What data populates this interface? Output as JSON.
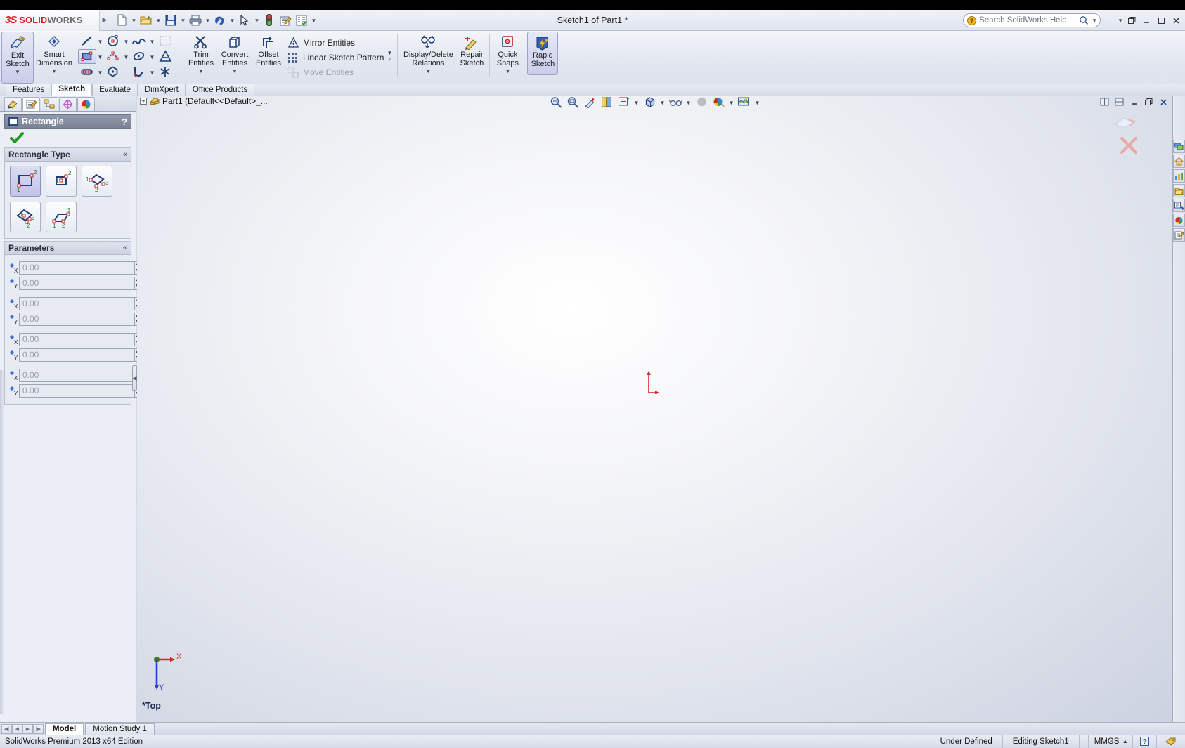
{
  "app": {
    "brand_mark": "3S",
    "brand_word_a": "SOLID",
    "brand_word_b": "WORKS",
    "document_title": "Sketch1 of Part1 *"
  },
  "search": {
    "placeholder": "Search SolidWorks Help",
    "icon": "help-search-icon"
  },
  "window_controls": {
    "restore_small": "restore-icon",
    "minimize": "minimize-icon",
    "maximize": "maximize-icon",
    "close": "close-icon",
    "help": "help-icon"
  },
  "quick_access": [
    {
      "name": "new-document",
      "icon": "new-doc-icon",
      "caret": true
    },
    {
      "name": "open-document",
      "icon": "open-folder-icon",
      "caret": true
    },
    {
      "name": "save-document",
      "icon": "save-disk-icon",
      "caret": true
    },
    {
      "name": "print-document",
      "icon": "printer-icon",
      "caret": true
    },
    {
      "name": "undo",
      "icon": "undo-arrow-icon",
      "caret": true
    },
    {
      "name": "select",
      "icon": "cursor-arrow-icon",
      "caret": true
    },
    {
      "name": "rebuild",
      "icon": "traffic-light-icon",
      "caret": false
    },
    {
      "name": "file-properties",
      "icon": "file-properties-icon",
      "caret": false
    },
    {
      "name": "options",
      "icon": "options-list-icon",
      "caret": true
    }
  ],
  "ribbon": {
    "exit_sketch": {
      "label_line1": "Exit",
      "label_line2": "Sketch",
      "icon": "exit-sketch-icon"
    },
    "smart_dimension": {
      "label_line1": "Smart",
      "label_line2": "Dimension",
      "icon": "smart-dimension-icon"
    },
    "sketch_tools": [
      {
        "name": "line-tool",
        "icon": "line-icon",
        "caret": true,
        "selected": false
      },
      {
        "name": "rectangle-tool",
        "icon": "rectangle-icon",
        "caret": true,
        "selected": true
      },
      {
        "name": "slot-tool",
        "icon": "slot-icon",
        "caret": true,
        "selected": false
      },
      {
        "name": "circle-tool",
        "icon": "circle-icon",
        "caret": true,
        "selected": false
      },
      {
        "name": "spline-point-tool",
        "icon": "spline-point-icon",
        "caret": true,
        "selected": false
      },
      {
        "name": "polygon-tool",
        "icon": "polygon-icon",
        "caret": false,
        "selected": false
      },
      {
        "name": "spline-tool",
        "icon": "spline-icon",
        "caret": true,
        "selected": false
      },
      {
        "name": "ellipse-tool",
        "icon": "ellipse-icon",
        "caret": true,
        "selected": false
      },
      {
        "name": "arc-tool",
        "icon": "arc-icon",
        "caret": true,
        "selected": false
      },
      {
        "name": "sketch-fillet-tool",
        "icon": "sketch-fillet-icon",
        "caret": false,
        "selected": false
      },
      {
        "name": "text-tool",
        "icon": "sketch-text-icon",
        "caret": false,
        "selected": false
      },
      {
        "name": "point-tool",
        "icon": "point-asterisk-icon",
        "caret": false,
        "selected": false
      }
    ],
    "trim_entities": {
      "label_line1": "Trim",
      "label_line2": "Entities",
      "icon": "trim-entities-icon"
    },
    "convert_entities": {
      "label_line1": "Convert",
      "label_line2": "Entities",
      "icon": "convert-entities-icon"
    },
    "offset_entities": {
      "label_line1": "Offset",
      "label_line2": "Entities",
      "icon": "offset-entities-icon"
    },
    "list_items": [
      {
        "name": "mirror-entities",
        "label": "Mirror Entities",
        "icon": "mirror-entities-icon",
        "caret": false,
        "disabled": false
      },
      {
        "name": "linear-sketch-pattern",
        "label": "Linear Sketch Pattern",
        "icon": "linear-sketch-pattern-icon",
        "caret": true,
        "disabled": false
      },
      {
        "name": "move-entities",
        "label": "Move Entities",
        "icon": "move-entities-icon",
        "caret": true,
        "disabled": true
      }
    ],
    "display_delete_relations": {
      "label_line1": "Display/Delete",
      "label_line2": "Relations",
      "icon": "display-delete-relations-icon"
    },
    "repair_sketch": {
      "label_line1": "Repair",
      "label_line2": "Sketch",
      "icon": "repair-sketch-icon"
    },
    "quick_snaps": {
      "label_line1": "Quick",
      "label_line2": "Snaps",
      "icon": "quick-snaps-icon"
    },
    "rapid_sketch": {
      "label_line1": "Rapid",
      "label_line2": "Sketch",
      "icon": "rapid-sketch-icon",
      "selected": true
    }
  },
  "command_tabs": [
    {
      "name": "tab-features",
      "label": "Features",
      "active": false
    },
    {
      "name": "tab-sketch",
      "label": "Sketch",
      "active": true
    },
    {
      "name": "tab-evaluate",
      "label": "Evaluate",
      "active": false
    },
    {
      "name": "tab-dimxpert",
      "label": "DimXpert",
      "active": false
    },
    {
      "name": "tab-office-products",
      "label": "Office Products",
      "active": false
    }
  ],
  "property_manager": {
    "tabs": [
      {
        "name": "pm-tab-feature-tree",
        "icon": "feature-tree-icon",
        "active": false
      },
      {
        "name": "pm-tab-property-manager",
        "icon": "property-manager-icon",
        "active": true
      },
      {
        "name": "pm-tab-configuration-manager",
        "icon": "configuration-manager-icon",
        "active": false
      },
      {
        "name": "pm-tab-dimxpert-manager",
        "icon": "dimxpert-manager-icon",
        "active": false
      },
      {
        "name": "pm-tab-display-manager",
        "icon": "display-manager-icon",
        "active": false
      }
    ],
    "title": "Rectangle",
    "title_icon": "rectangle-icon",
    "help_glyph": "?",
    "ok_button": "ok-check-icon",
    "sections": {
      "rectangle_type": {
        "label": "Rectangle Type",
        "collapse_glyph": "«",
        "options": [
          {
            "name": "corner-rectangle",
            "icon": "corner-rectangle-icon",
            "selected": true
          },
          {
            "name": "center-rectangle",
            "icon": "center-rectangle-icon",
            "selected": false
          },
          {
            "name": "3-point-corner-rectangle",
            "icon": "three-point-corner-rectangle-icon",
            "selected": false
          },
          {
            "name": "3-point-center-rectangle",
            "icon": "three-point-center-rectangle-icon",
            "selected": false
          },
          {
            "name": "parallelogram",
            "icon": "parallelogram-icon",
            "selected": false
          }
        ]
      },
      "parameters": {
        "label": "Parameters",
        "collapse_glyph": "«",
        "fields": [
          {
            "name": "point1-x",
            "axis": "X",
            "value": "0.00"
          },
          {
            "name": "point1-y",
            "axis": "Y",
            "value": "0.00"
          },
          {
            "name": "point2-x",
            "axis": "X",
            "value": "0.00"
          },
          {
            "name": "point2-y",
            "axis": "Y",
            "value": "0.00"
          },
          {
            "name": "point3-x",
            "axis": "X",
            "value": "0.00"
          },
          {
            "name": "point3-y",
            "axis": "Y",
            "value": "0.00"
          },
          {
            "name": "point4-x",
            "axis": "X",
            "value": "0.00"
          },
          {
            "name": "point4-y",
            "axis": "Y",
            "value": "0.00"
          }
        ]
      }
    }
  },
  "feature_tree": {
    "root_label": "Part1 (Default<<Default>_...",
    "expand_glyph": "+",
    "icon": "part-icon"
  },
  "heads_up_view": [
    {
      "name": "zoom-to-fit",
      "icon": "zoom-to-fit-icon",
      "caret": false
    },
    {
      "name": "zoom-to-area",
      "icon": "zoom-to-area-icon",
      "caret": false
    },
    {
      "name": "previous-view",
      "icon": "previous-view-icon",
      "caret": false
    },
    {
      "name": "section-view",
      "icon": "section-view-icon",
      "caret": false
    },
    {
      "name": "view-orientation",
      "icon": "view-orientation-icon",
      "caret": true
    },
    {
      "name": "display-style",
      "icon": "display-style-icon",
      "caret": true
    },
    {
      "name": "hide-show-items",
      "icon": "hide-show-items-icon",
      "caret": true
    },
    {
      "name": "edit-appearance",
      "icon": "edit-appearance-icon",
      "caret": false
    },
    {
      "name": "apply-scene",
      "icon": "apply-scene-icon",
      "caret": true
    },
    {
      "name": "view-settings",
      "icon": "view-settings-icon",
      "caret": true
    }
  ],
  "view_corner_buttons": [
    {
      "name": "viewport-single",
      "icon": "viewport-single-icon"
    },
    {
      "name": "viewport-split",
      "icon": "viewport-split-icon"
    },
    {
      "name": "window-minimize",
      "icon": "minimize-icon"
    },
    {
      "name": "window-restore",
      "icon": "restore-icon"
    },
    {
      "name": "window-close",
      "icon": "close-icon"
    }
  ],
  "graphics": {
    "view_label": "*Top",
    "axis_x_label": "X",
    "axis_y_label": "Y",
    "origin_color": "#d02a2a"
  },
  "task_pane": [
    {
      "name": "task-pane-solidworks-resources",
      "icon": "sw-resources-icon"
    },
    {
      "name": "task-pane-design-library",
      "icon": "design-library-home-icon"
    },
    {
      "name": "task-pane-file-explorer",
      "icon": "file-explorer-icon"
    },
    {
      "name": "task-pane-search",
      "icon": "open-folder-icon"
    },
    {
      "name": "task-pane-view-palette",
      "icon": "view-palette-icon"
    },
    {
      "name": "task-pane-appearances-scenes",
      "icon": "appearances-scenes-icon"
    },
    {
      "name": "task-pane-custom-properties",
      "icon": "custom-properties-icon"
    }
  ],
  "bottom_tabs": {
    "nav": [
      "first",
      "previous",
      "next",
      "last"
    ],
    "tabs": [
      {
        "name": "bottom-tab-model",
        "label": "Model",
        "active": true
      },
      {
        "name": "bottom-tab-motion-study",
        "label": "Motion Study 1",
        "active": false
      }
    ]
  },
  "status_bar": {
    "edition": "SolidWorks Premium 2013 x64 Edition",
    "sketch_state": "Under Defined",
    "editing": "Editing Sketch1",
    "units": "MMGS",
    "units_caret": "▴",
    "help_glyph": "?",
    "tag_icon": "tag-icon"
  }
}
